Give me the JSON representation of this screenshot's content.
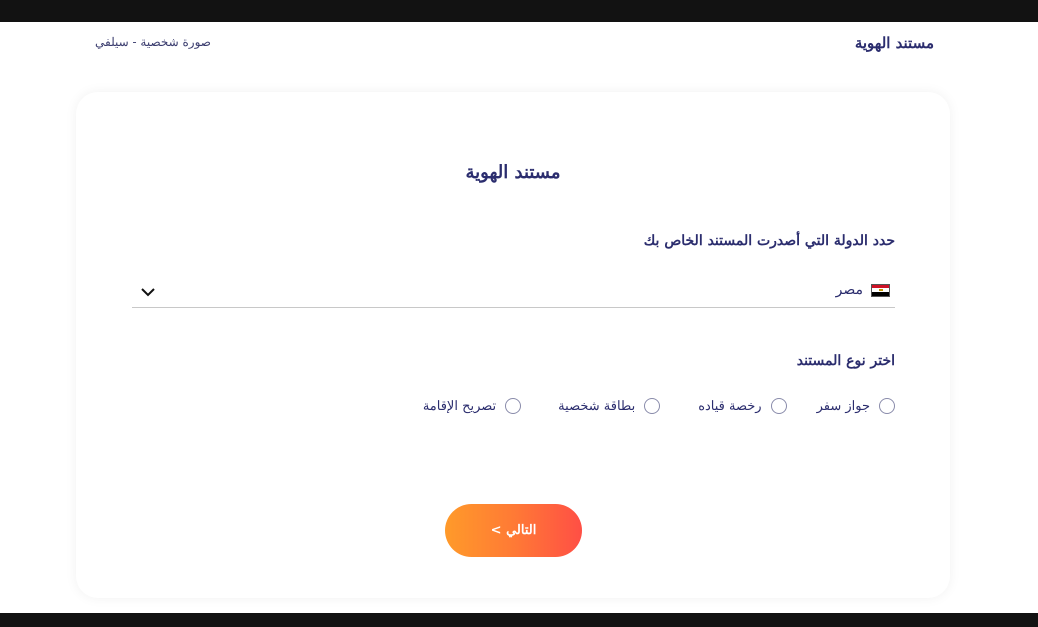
{
  "header": {
    "title": "مستند الهوية",
    "step_label": "صورة شخصية - سيلفي"
  },
  "card": {
    "title": "مستند الهوية",
    "country_label": "حدد الدولة التي أصدرت المستند الخاص بك",
    "country_value": "مصر",
    "country_flag_icon": "egypt-flag-icon",
    "document_label": "اختر نوع المستند",
    "document_options": [
      {
        "label": "جواز سفر",
        "selected": false
      },
      {
        "label": "رخصة قياده",
        "selected": false
      },
      {
        "label": "بطاقة شخصية",
        "selected": false
      },
      {
        "label": "تصريح الإقامة",
        "selected": false
      }
    ],
    "next_button": "التالي >"
  },
  "colors": {
    "primary_text": "#2b2d6e",
    "button_gradient_start": "#ff9a2a",
    "button_gradient_end": "#ff4f45"
  }
}
